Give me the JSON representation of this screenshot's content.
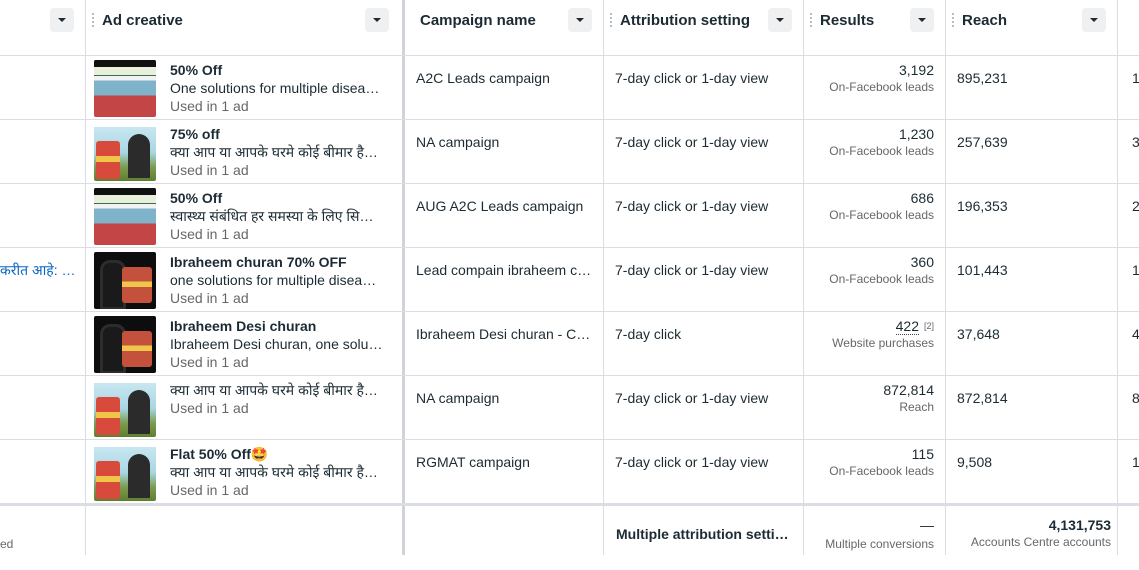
{
  "headers": {
    "ad_creative": "Ad creative",
    "campaign_name": "Campaign name",
    "attribution_setting": "Attribution setting",
    "results": "Results",
    "reach": "Reach"
  },
  "rows": [
    {
      "left": "",
      "ad_title": "50% Off",
      "ad_body": "One solutions for multiple disea…",
      "ad_used": "Used in 1 ad",
      "campaign": "A2C Leads campaign",
      "attribution": "7-day click or 1-day view",
      "result_value": "3,192",
      "result_sup": "",
      "result_type": "On-Facebook leads",
      "reach": "895,231",
      "next": "1"
    },
    {
      "left": "",
      "ad_title": "75% off",
      "ad_body": "क्या आप या आपके घरमे कोई बीमार है…",
      "ad_used": "Used in 1 ad",
      "campaign": "NA campaign",
      "attribution": "7-day click or 1-day view",
      "result_value": "1,230",
      "result_sup": "",
      "result_type": "On-Facebook leads",
      "reach": "257,639",
      "next": "3"
    },
    {
      "left": "",
      "ad_title": "50% Off",
      "ad_body": "स्वास्थ्य संबंधित हर समस्या के लिए सि…",
      "ad_used": "Used in 1 ad",
      "campaign": "AUG A2C Leads campaign",
      "attribution": "7-day click or 1-day view",
      "result_value": "686",
      "result_sup": "",
      "result_type": "On-Facebook leads",
      "reach": "196,353",
      "next": "2"
    },
    {
      "left": "करीत आहे: …",
      "ad_title": "Ibraheem churan 70% OFF",
      "ad_body": "one solutions for multiple disea…",
      "ad_used": "Used in 1 ad",
      "campaign": "Lead compain ibraheem c…",
      "attribution": "7-day click or 1-day view",
      "result_value": "360",
      "result_sup": "",
      "result_type": "On-Facebook leads",
      "reach": "101,443",
      "next": "1"
    },
    {
      "left": "",
      "ad_title": "Ibraheem Desi churan",
      "ad_body": "Ibraheem Desi churan, one solu…",
      "ad_used": "Used in 1 ad",
      "campaign": "Ibraheem Desi churan - Co…",
      "attribution": "7-day click",
      "result_value": "422",
      "result_sup": "[2]",
      "result_type": "Website purchases",
      "reach": "37,648",
      "next": "4"
    },
    {
      "left": "",
      "ad_title": "",
      "ad_body": "क्या आप या आपके घरमे कोई बीमार है…",
      "ad_used": "Used in 1 ad",
      "campaign": "NA campaign",
      "attribution": "7-day click or 1-day view",
      "result_value": "872,814",
      "result_sup": "",
      "result_type": "Reach",
      "reach": "872,814",
      "next": "8"
    },
    {
      "left": "",
      "ad_title": "Flat 50% Off🤩",
      "ad_body": "क्या आप या आपके घरमे कोई बीमार है…",
      "ad_used": "Used in 1 ad",
      "campaign": "RGMAT campaign",
      "attribution": "7-day click or 1-day view",
      "result_value": "115",
      "result_sup": "",
      "result_type": "On-Facebook leads",
      "reach": "9,508",
      "next": "1"
    }
  ],
  "footer": {
    "left": "ed",
    "attribution": "Multiple attribution settin…",
    "results_value": "—",
    "results_sub": "Multiple conversions",
    "reach_value": "4,131,753",
    "reach_sub": "Accounts Centre accounts"
  },
  "icons": {
    "sort": "chevron-down-icon"
  }
}
